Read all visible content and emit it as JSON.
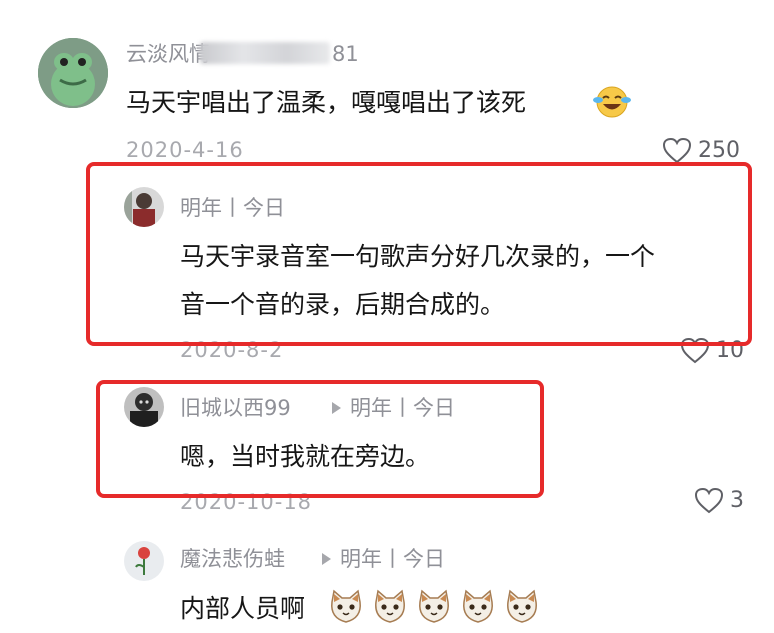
{
  "colors": {
    "highlight_border": "#e62a2a",
    "username_text": "#8f9097",
    "date_text": "#a8a9ae",
    "content_text": "#161616"
  },
  "comments": [
    {
      "username": "云淡风情",
      "username_suffix": "81",
      "content": "马天宇唱出了温柔，嘎嘎唱出了该死",
      "emoji": "face-with-tears-of-joy-icon",
      "date": "2020-4-16",
      "likes": "250"
    },
    {
      "username": "明年丨今日",
      "content_line1": "马天宇录音室一句歌声分好几次录的，一个",
      "content_line2": "音一个音的录，后期合成的。",
      "date": "2020-8-2",
      "likes": "10",
      "highlighted": true
    },
    {
      "username": "旧城以西99",
      "reply_to": "明年丨今日",
      "content": "嗯，当时我就在旁边。",
      "date": "2020-10-18",
      "likes": "3",
      "highlighted": true
    },
    {
      "username": "魔法悲伤蛙",
      "reply_to": "明年丨今日",
      "content": "内部人员啊",
      "emoji": "cat-face-icon",
      "emoji_count": 5
    }
  ]
}
